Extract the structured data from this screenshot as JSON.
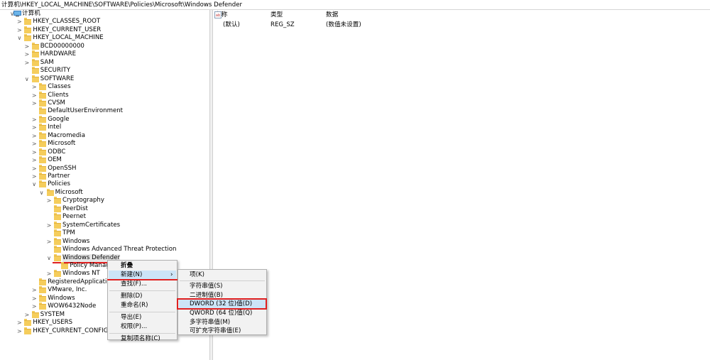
{
  "address": "计算机\\HKEY_LOCAL_MACHINE\\SOFTWARE\\Policies\\Microsoft\\Windows Defender",
  "tree": [
    {
      "label": "计算机",
      "depth": 0,
      "chev": "∨",
      "icon": "computer"
    },
    {
      "label": "HKEY_CLASSES_ROOT",
      "depth": 1,
      "chev": ">"
    },
    {
      "label": "HKEY_CURRENT_USER",
      "depth": 1,
      "chev": ">"
    },
    {
      "label": "HKEY_LOCAL_MACHINE",
      "depth": 1,
      "chev": "∨"
    },
    {
      "label": "BCD00000000",
      "depth": 2,
      "chev": ">"
    },
    {
      "label": "HARDWARE",
      "depth": 2,
      "chev": ">"
    },
    {
      "label": "SAM",
      "depth": 2,
      "chev": ">"
    },
    {
      "label": "SECURITY",
      "depth": 2,
      "chev": ""
    },
    {
      "label": "SOFTWARE",
      "depth": 2,
      "chev": "∨"
    },
    {
      "label": "Classes",
      "depth": 3,
      "chev": ">"
    },
    {
      "label": "Clients",
      "depth": 3,
      "chev": ">"
    },
    {
      "label": "CVSM",
      "depth": 3,
      "chev": ">"
    },
    {
      "label": "DefaultUserEnvironment",
      "depth": 3,
      "chev": ""
    },
    {
      "label": "Google",
      "depth": 3,
      "chev": ">"
    },
    {
      "label": "Intel",
      "depth": 3,
      "chev": ">"
    },
    {
      "label": "Macromedia",
      "depth": 3,
      "chev": ">"
    },
    {
      "label": "Microsoft",
      "depth": 3,
      "chev": ">"
    },
    {
      "label": "ODBC",
      "depth": 3,
      "chev": ">"
    },
    {
      "label": "OEM",
      "depth": 3,
      "chev": ">"
    },
    {
      "label": "OpenSSH",
      "depth": 3,
      "chev": ">"
    },
    {
      "label": "Partner",
      "depth": 3,
      "chev": ">"
    },
    {
      "label": "Policies",
      "depth": 3,
      "chev": "∨"
    },
    {
      "label": "Microsoft",
      "depth": 4,
      "chev": "∨"
    },
    {
      "label": "Cryptography",
      "depth": 5,
      "chev": ">"
    },
    {
      "label": "PeerDist",
      "depth": 5,
      "chev": ""
    },
    {
      "label": "Peernet",
      "depth": 5,
      "chev": ""
    },
    {
      "label": "SystemCertificates",
      "depth": 5,
      "chev": ">"
    },
    {
      "label": "TPM",
      "depth": 5,
      "chev": ""
    },
    {
      "label": "Windows",
      "depth": 5,
      "chev": ">"
    },
    {
      "label": "Windows Advanced Threat Protection",
      "depth": 5,
      "chev": ""
    },
    {
      "label": "Windows Defender",
      "depth": 5,
      "chev": "∨",
      "selected": true
    },
    {
      "label": "Policy Manager",
      "depth": 6,
      "chev": ""
    },
    {
      "label": "Windows NT",
      "depth": 5,
      "chev": ">"
    },
    {
      "label": "RegisteredApplications",
      "depth": 3,
      "chev": ""
    },
    {
      "label": "VMware, Inc.",
      "depth": 3,
      "chev": ">"
    },
    {
      "label": "Windows",
      "depth": 3,
      "chev": ">"
    },
    {
      "label": "WOW6432Node",
      "depth": 3,
      "chev": ">"
    },
    {
      "label": "SYSTEM",
      "depth": 2,
      "chev": ">"
    },
    {
      "label": "HKEY_USERS",
      "depth": 1,
      "chev": ">"
    },
    {
      "label": "HKEY_CURRENT_CONFIG",
      "depth": 1,
      "chev": ">"
    }
  ],
  "list": {
    "headers": {
      "name": "名称",
      "type": "类型",
      "data": "数据"
    },
    "rows": [
      {
        "name": "(默认)",
        "type": "REG_SZ",
        "data": "(数值未设置)",
        "icon": "ab"
      }
    ]
  },
  "context_menu": {
    "items": [
      {
        "label": "折叠",
        "bold": true
      },
      {
        "label": "新建(N)",
        "submenu": true
      },
      {
        "label": "查找(F)..."
      },
      {
        "sep": true
      },
      {
        "label": "删除(D)"
      },
      {
        "label": "重命名(R)"
      },
      {
        "sep": true
      },
      {
        "label": "导出(E)"
      },
      {
        "label": "权限(P)..."
      },
      {
        "sep": true
      },
      {
        "label": "复制项名称(C)"
      }
    ]
  },
  "submenu": {
    "items": [
      {
        "label": "项(K)"
      },
      {
        "sep": true
      },
      {
        "label": "字符串值(S)"
      },
      {
        "label": "二进制值(B)"
      },
      {
        "label": "DWORD (32 位)值(D)",
        "highlight": true
      },
      {
        "label": "QWORD (64 位)值(Q)"
      },
      {
        "label": "多字符串值(M)"
      },
      {
        "label": "可扩充字符串值(E)"
      }
    ]
  },
  "colors": {
    "highlight_box": "#e02020",
    "hover": "#cce4f7",
    "folder": "#f5cd5c"
  }
}
